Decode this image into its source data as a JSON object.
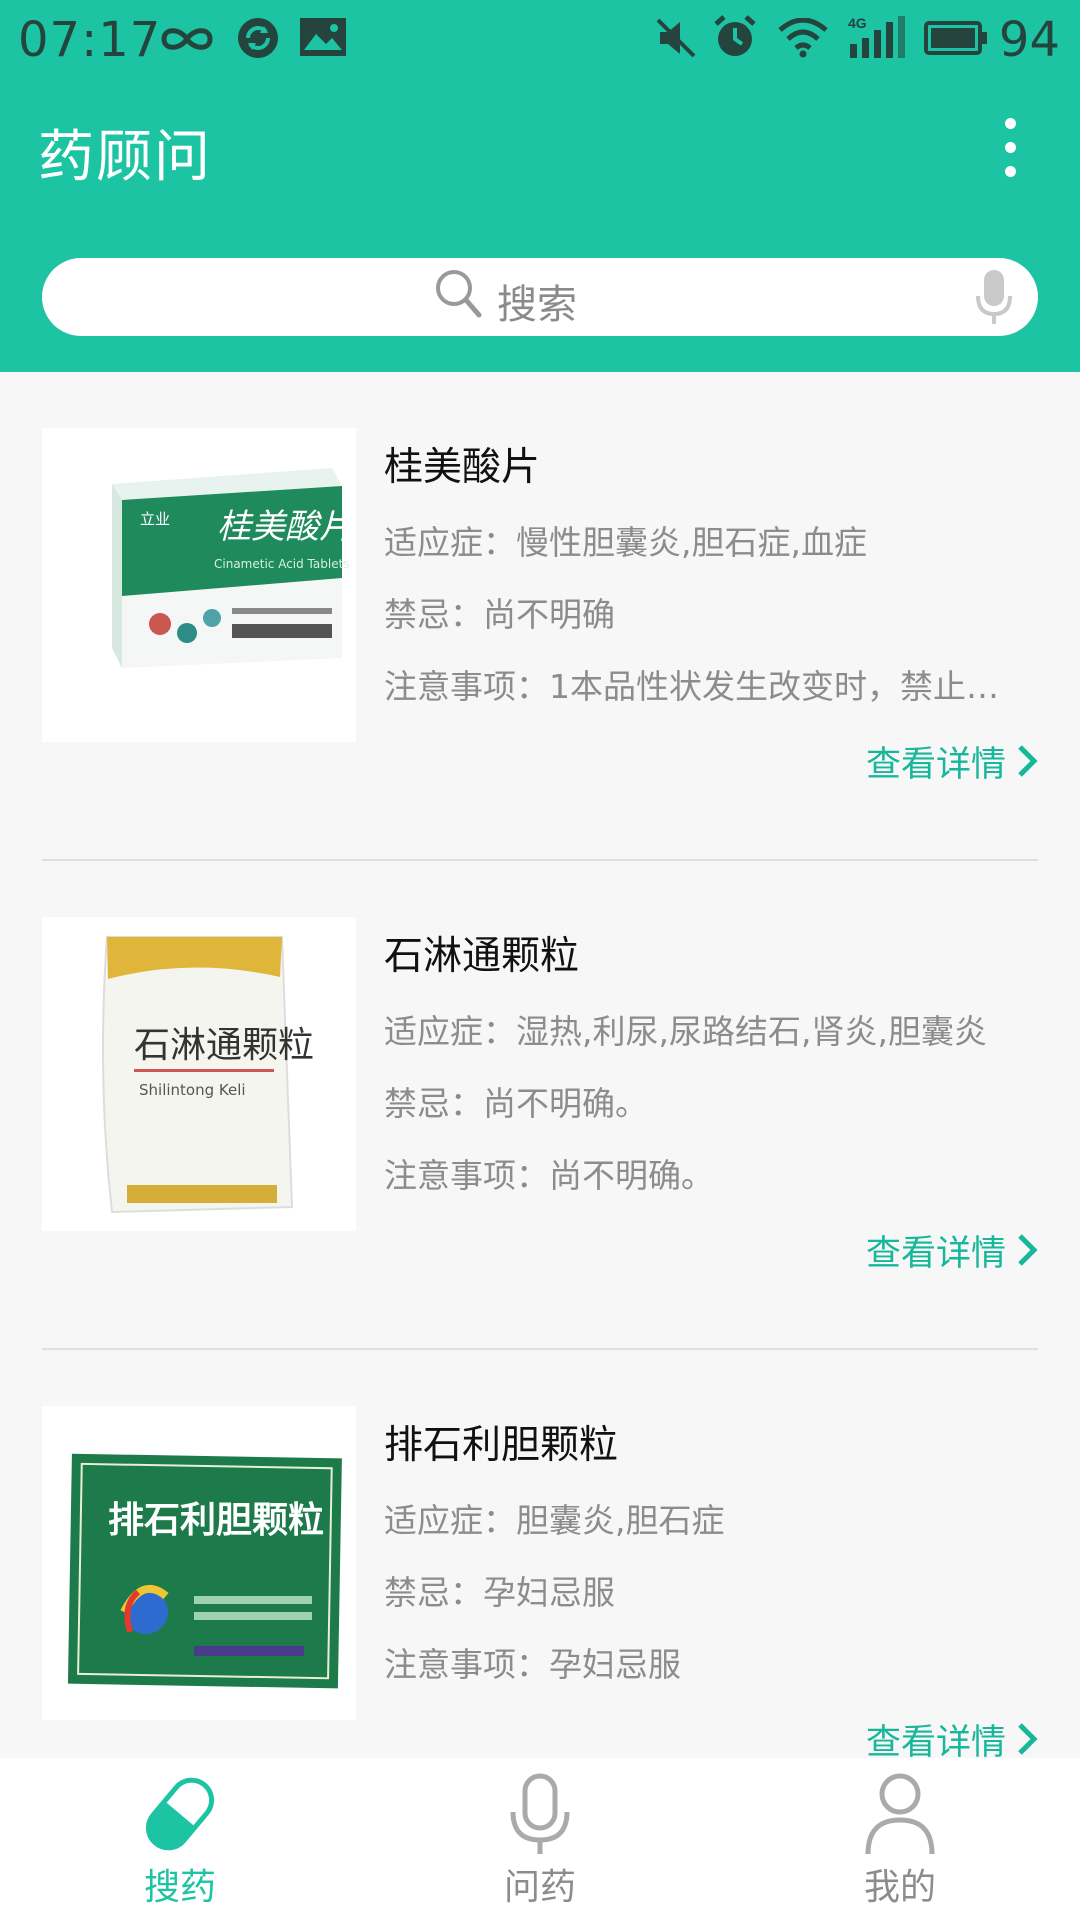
{
  "status_bar": {
    "time": "07:17",
    "battery": "94"
  },
  "app": {
    "title": "药顾问"
  },
  "search": {
    "placeholder": "搜索"
  },
  "drugs": [
    {
      "name": "桂美酸片",
      "indication": "适应症：慢性胆囊炎,胆石症,血症",
      "contraindication": "禁忌：尚不明确",
      "notes": "注意事项：1本品性状发生改变时，禁止…",
      "detail_label": "查看详情",
      "package_text": "桂美酸片",
      "package_brand": "立业",
      "package_subtext": "Cinametic Acid Tablets"
    },
    {
      "name": "石淋通颗粒",
      "indication": "适应症：湿热,利尿,尿路结石,肾炎,胆囊炎",
      "contraindication": "禁忌：尚不明确。",
      "notes": "注意事项：尚不明确。",
      "detail_label": "查看详情",
      "package_text": "石淋通颗粒",
      "package_subtext": "Shilintong Keli"
    },
    {
      "name": "排石利胆颗粒",
      "indication": "适应症：胆囊炎,胆石症",
      "contraindication": "禁忌：孕妇忌服",
      "notes": "注意事项：孕妇忌服",
      "detail_label": "查看详情",
      "package_text": "排石利胆颗粒"
    }
  ],
  "bottom_nav": [
    {
      "label": "搜药",
      "icon": "pill-icon",
      "active": true
    },
    {
      "label": "问药",
      "icon": "microphone-icon",
      "active": false
    },
    {
      "label": "我的",
      "icon": "user-icon",
      "active": false
    }
  ],
  "colors": {
    "primary": "#1cc4a3",
    "accent_text": "#16b79a",
    "secondary_text": "#8c8c8c"
  }
}
